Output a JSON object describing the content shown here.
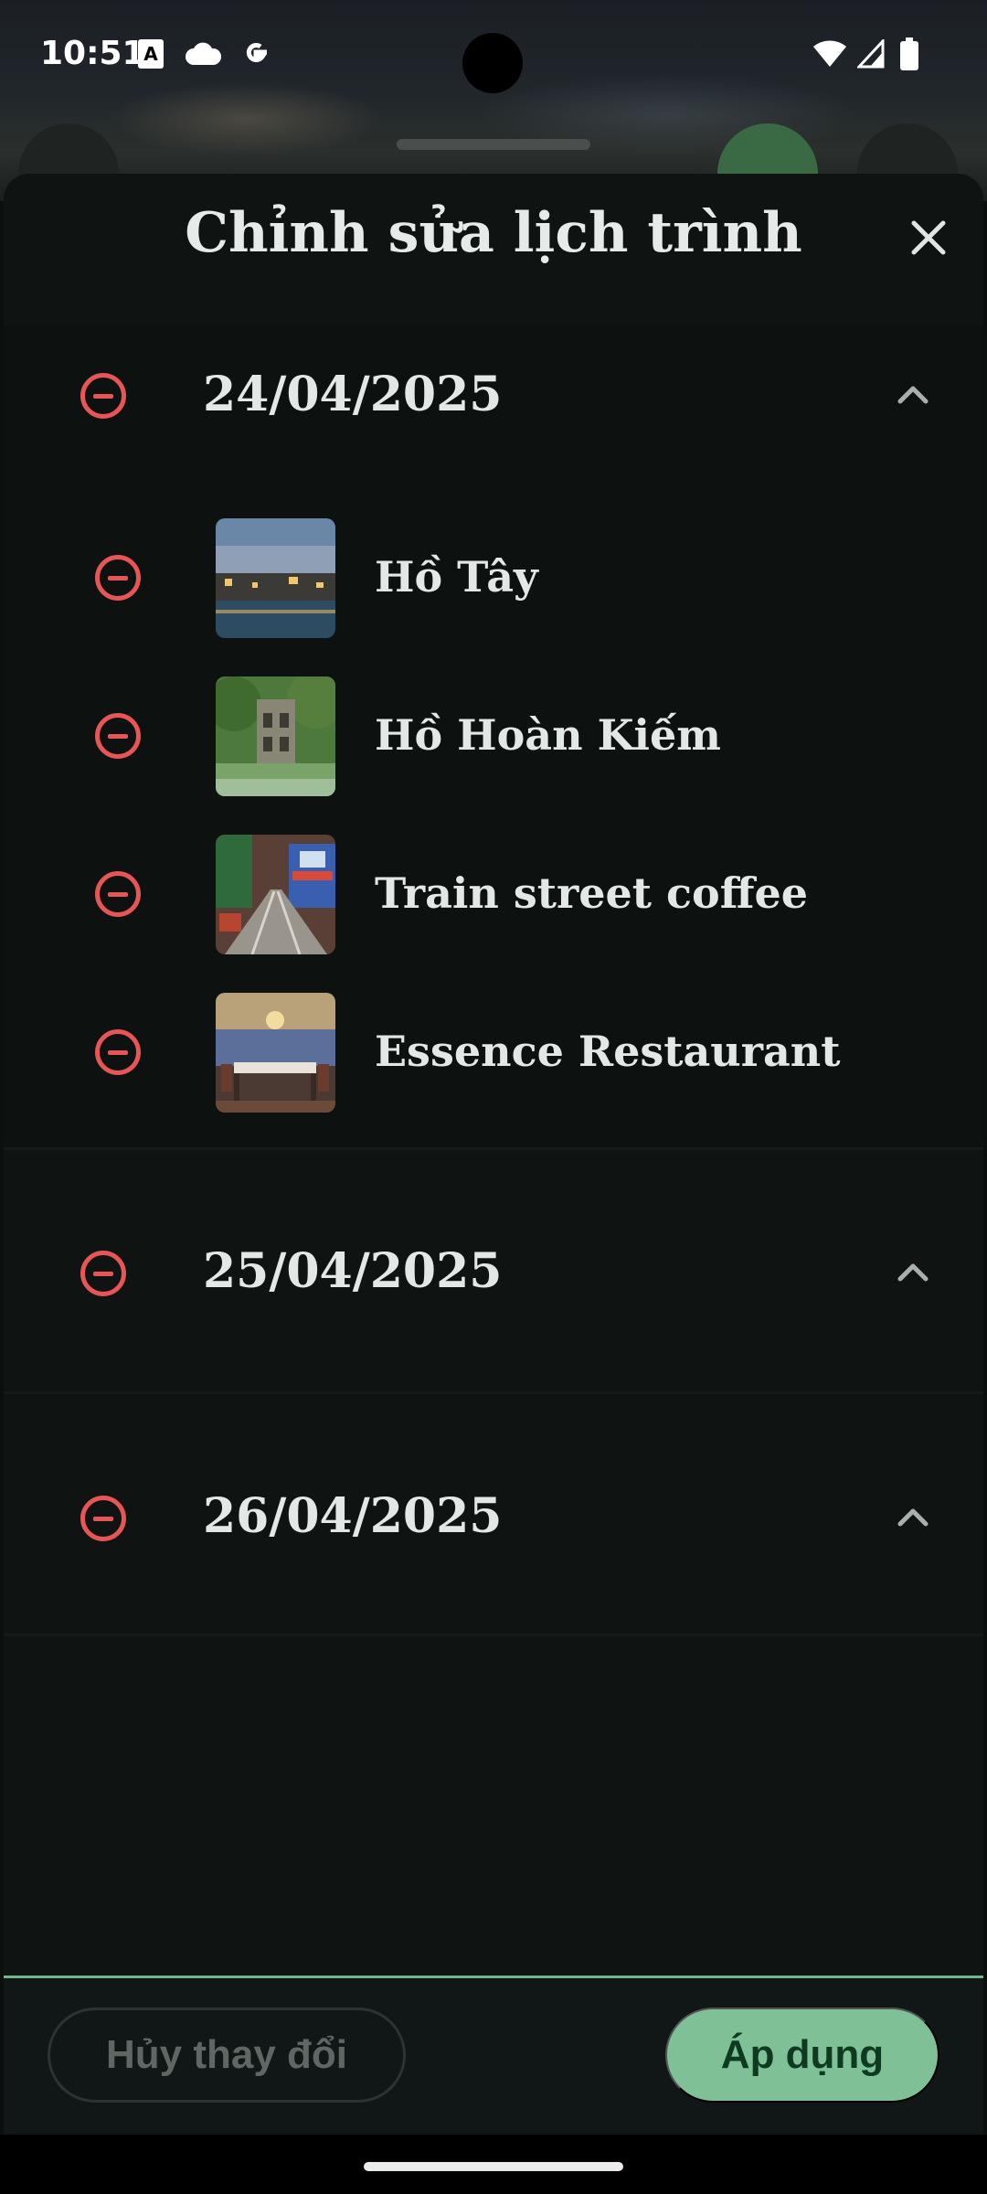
{
  "status_bar": {
    "time": "10:51",
    "icons": [
      "translate-icon",
      "cloud-icon",
      "google-icon",
      "wifi-icon",
      "signal-icon",
      "battery-icon"
    ]
  },
  "sheet": {
    "title": "Chỉnh sửa lịch trình",
    "close_icon": "close-icon"
  },
  "days": [
    {
      "date": "24/04/2025",
      "expanded": true,
      "places": [
        {
          "name": "Hồ Tây"
        },
        {
          "name": "Hồ Hoàn Kiếm"
        },
        {
          "name": "Train street coffee"
        },
        {
          "name": "Essence Restaurant"
        }
      ]
    },
    {
      "date": "25/04/2025",
      "expanded": false,
      "places": []
    },
    {
      "date": "26/04/2025",
      "expanded": false,
      "places": []
    }
  ],
  "actions": {
    "cancel_label": "Hủy thay đổi",
    "apply_label": "Áp dụng"
  },
  "colors": {
    "accent": "#7fc096",
    "remove": "#e85555",
    "background": "#0f1413"
  }
}
